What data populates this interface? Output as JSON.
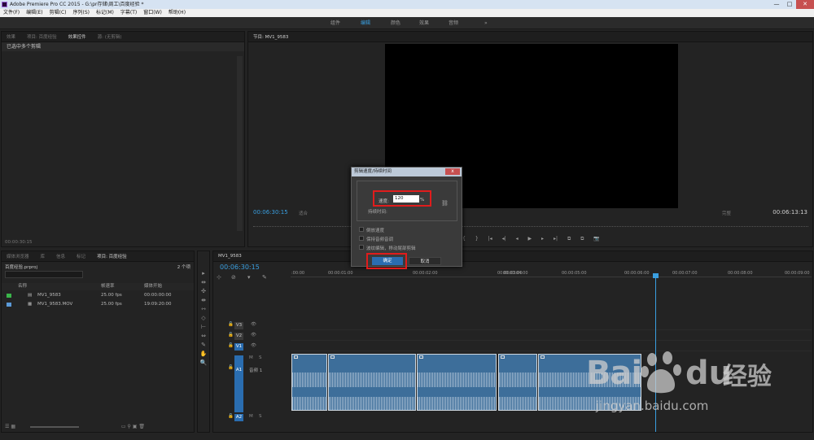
{
  "window": {
    "title": "Adobe Premiere Pro CC 2015 - G:\\pr存储\\周工\\百度经验 *",
    "min": "—",
    "max": "□",
    "close": "✕"
  },
  "menu": [
    "文件(F)",
    "编辑(E)",
    "剪辑(C)",
    "序列(S)",
    "标记(M)",
    "字幕(T)",
    "窗口(W)",
    "帮助(H)"
  ],
  "workspaces": {
    "items": [
      "组件",
      "编辑",
      "颜色",
      "效果",
      "音频"
    ],
    "active": "编辑",
    "more": "»"
  },
  "effect_panel": {
    "tabs": [
      "效果",
      "项目: 百度经验",
      "效果控件",
      "源: (无剪辑)"
    ],
    "selected_label": "已选中多个剪辑",
    "timecode": "00:00:30:15"
  },
  "program_monitor": {
    "tab": "节目: MV1_9583",
    "timecode_left": "00:06:30:15",
    "fit_left": "适合",
    "fit_right": "完整",
    "timecode_right": "00:06:13:13",
    "transport": [
      "{",
      "}",
      "|◂",
      "◂|",
      "◂",
      "▶",
      "▸",
      "▸|",
      "⧉",
      "⧉",
      "📷"
    ]
  },
  "project_panel": {
    "tabs": [
      "媒体浏览器",
      "库",
      "信息",
      "标记",
      "项目: 百度经验"
    ],
    "file": "百度经验.prproj",
    "count": "2 个项",
    "search_placeholder": "",
    "columns": {
      "name": "名称",
      "fps": "帧速率",
      "start": "媒体开始"
    },
    "rows": [
      {
        "name": "MV1_9583",
        "fps": "25.00 fps",
        "start": "00:00:00:00",
        "color": "#3ab54a"
      },
      {
        "name": "MV1_9583.MOV",
        "fps": "25.00 fps",
        "start": "19:09:20:00",
        "color": "#5b9ad8"
      }
    ]
  },
  "tools": [
    "▸",
    "⇹",
    "✣",
    "⇼",
    "⇿",
    "◇",
    "⊢",
    "⇔",
    "✎",
    "✋",
    "🔍"
  ],
  "timeline": {
    "tab": "MV1_9583",
    "timecode": "00:06:30:15",
    "ticks": [
      ":00:00",
      "00:00:01:00",
      "00:00:02:00",
      "00:00:03:00",
      "00:00:04:00",
      "00:00:05:00",
      "00:00:06:00",
      "00:00:07:00",
      "00:00:08:00",
      "00:00:09:00"
    ],
    "tracks": [
      "V3",
      "V2",
      "V1",
      "A1",
      "A2"
    ],
    "a1_name": "音频 1"
  },
  "dialog": {
    "title": "剪辑速度/持续时间",
    "close": "x",
    "speed_label": "速度:",
    "speed_value": "120",
    "pct": "%",
    "duration_label": "持续时间:",
    "opt_reverse": "倒放速度",
    "opt_pitch": "保持音频音调",
    "opt_ripple": "波纹编辑，移动尾部剪辑",
    "ok": "确定",
    "cancel": "取消"
  },
  "watermark": {
    "bai": "Bai",
    "du": "du",
    "cn": "经验",
    "url": "jingyan.baidu.com"
  }
}
